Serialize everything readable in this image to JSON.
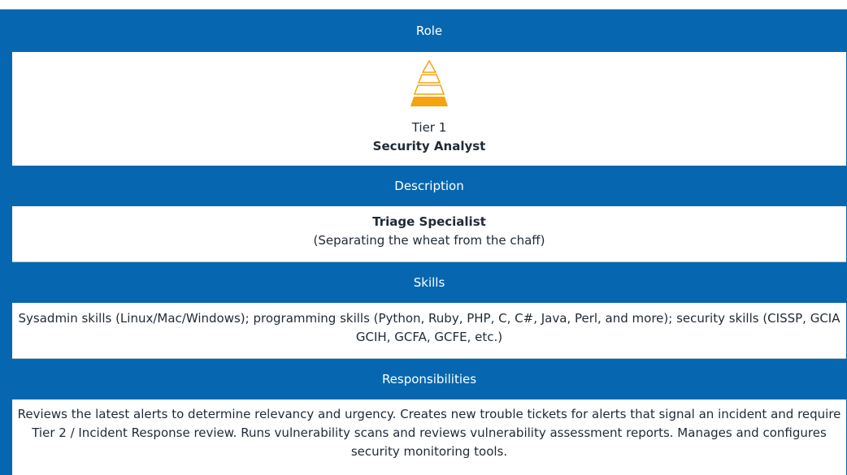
{
  "sections": {
    "role": {
      "header": "Role",
      "tier": "Tier 1",
      "title": "Security Analyst",
      "icon": "pyramid-tier-1-icon"
    },
    "description": {
      "header": "Description",
      "title": "Triage Specialist",
      "subtitle": "(Separating the wheat from the chaff)"
    },
    "skills": {
      "header": "Skills",
      "line1": "Sysadmin skills (Linux/Mac/Windows); programming skills (Python, Ruby, PHP, C, C#, Java, Perl, and more); security skills (CISSP, GCIA",
      "line2": "GCIH, GCFA, GCFE, etc.)"
    },
    "responsibilities": {
      "header": "Responsibilities",
      "line1": "Reviews the latest alerts to determine relevancy and urgency. Creates new trouble tickets for alerts that signal an incident and require",
      "line2": "Tier 2 / Incident Response review. Runs vulnerability scans and reviews vulnerability assessment reports. Manages and configures",
      "line3": "security monitoring tools."
    }
  },
  "colors": {
    "header_bg": "#0667b0",
    "pyramid_fill": "#f5a30e",
    "pyramid_outline": "#f5a30e"
  }
}
